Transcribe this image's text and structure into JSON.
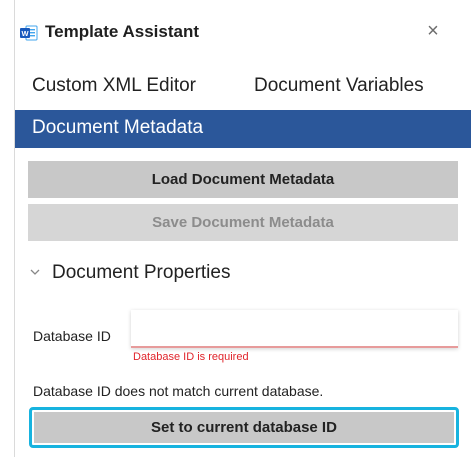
{
  "header": {
    "title": "Template Assistant",
    "icon": "word-document-icon",
    "close": "×"
  },
  "tabs": [
    {
      "label": "Custom XML Editor",
      "active": false
    },
    {
      "label": "Document Variables",
      "active": false
    },
    {
      "label": "Document Metadata",
      "active": true
    }
  ],
  "buttons": {
    "load": "Load Document Metadata",
    "save": "Save Document Metadata",
    "save_disabled": true
  },
  "section": {
    "title": "Document Properties",
    "expanded": true
  },
  "database_id": {
    "label": "Database ID",
    "value": "",
    "error": "Database ID is required"
  },
  "mismatch_message": "Database ID does not match current database.",
  "set_button": "Set to current database ID",
  "colors": {
    "accent": "#2b579a",
    "error": "#e0242b",
    "focus": "#17b3df"
  }
}
